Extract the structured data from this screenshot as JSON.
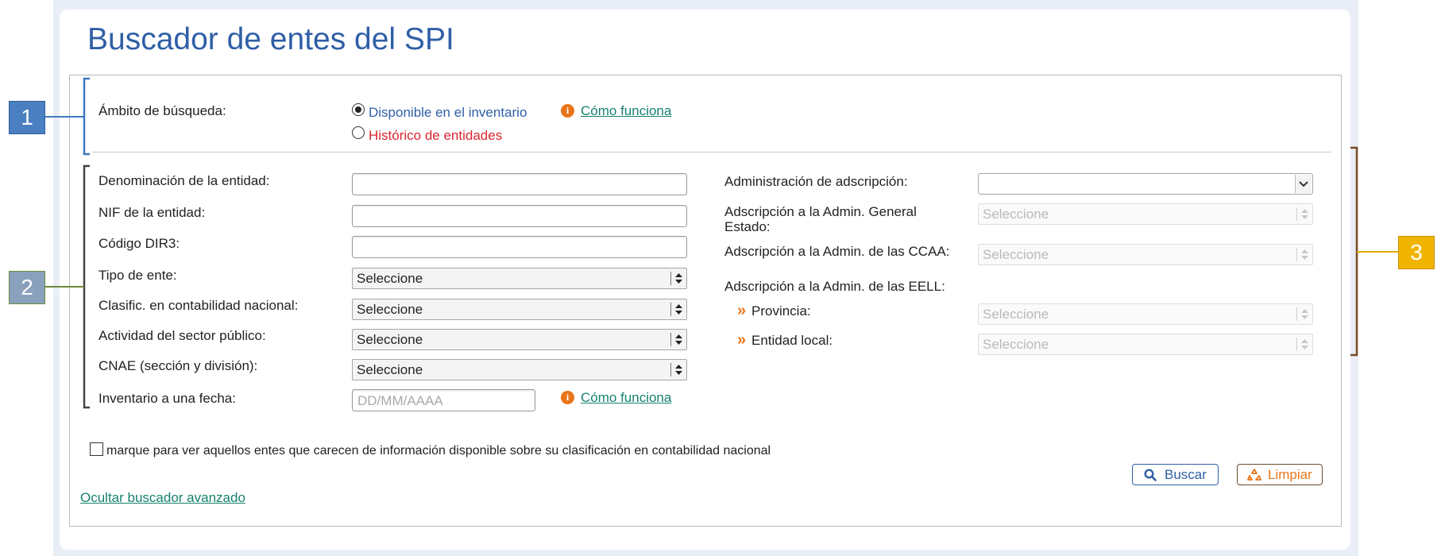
{
  "title": "Buscador de entes del SPI",
  "scope": {
    "label": "Ámbito de búsqueda:",
    "option_available": "Disponible en el inventario",
    "option_history": "Histórico de entidades",
    "selected": "Disponible en el inventario",
    "help_link": "Cómo funciona"
  },
  "left_fields": {
    "denominacion": "Denominación de la entidad:",
    "nif": "NIF de la entidad:",
    "dir3": "Código DIR3:",
    "tipo_ente": "Tipo de ente:",
    "clasific": "Clasific. en contabilidad nacional:",
    "actividad": "Actividad del sector público:",
    "cnae": "CNAE (sección y división):",
    "inventario_fecha": "Inventario a una fecha:"
  },
  "select_default": "Seleccione",
  "date_placeholder": "DD/MM/AAAA",
  "date_help_link": "Cómo funciona",
  "right_fields": {
    "administracion": "Administración de adscripción:",
    "admin_general_line1": "Adscripción a la Admin. General",
    "admin_general_line2": "Estado:",
    "admin_ccaa": "Adscripción a la Admin. de las CCAA:",
    "admin_eell": "Adscripción a la Admin. de las EELL:",
    "provincia": "Provincia:",
    "entidad_local": "Entidad local:"
  },
  "checkbox_label": "marque para ver aquellos entes que carecen de información disponible sobre su clasificación en contabilidad nacional",
  "buttons": {
    "search": "Buscar",
    "clear": "Limpiar"
  },
  "hide_advanced_link": "Ocultar buscador avanzado",
  "callouts": [
    {
      "label": "1",
      "color": "#4a7fc1"
    },
    {
      "label": "2",
      "color": "#8aa1bd"
    },
    {
      "label": "3",
      "color": "#f0b400"
    }
  ],
  "colors": {
    "title": "#2f5fa6",
    "link": "#17826e",
    "history": "#d9262e",
    "accent": "#e8751a"
  }
}
